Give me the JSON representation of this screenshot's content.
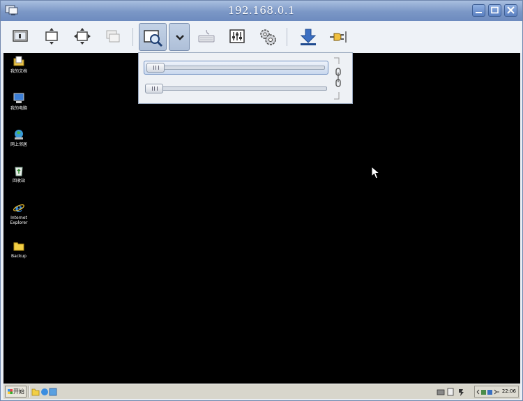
{
  "window": {
    "title": "192.168.0.1"
  },
  "toolbar": {
    "buttons": [
      {
        "name": "fullscreen",
        "icon": "fullscreen-icon"
      },
      {
        "name": "fit-width",
        "icon": "fit-width-icon"
      },
      {
        "name": "fit-window",
        "icon": "fit-window-icon"
      },
      {
        "name": "windowed",
        "icon": "windowed-icon"
      },
      {
        "name": "zoom",
        "icon": "zoom-icon",
        "active": true
      },
      {
        "name": "zoom-dropdown",
        "icon": "chevron-down-icon"
      },
      {
        "name": "keyboard",
        "icon": "keyboard-icon"
      },
      {
        "name": "adjustments",
        "icon": "equalizer-icon"
      },
      {
        "name": "settings",
        "icon": "gears-icon"
      },
      {
        "name": "download",
        "icon": "download-arrow-icon"
      },
      {
        "name": "disconnect",
        "icon": "plug-icon"
      }
    ]
  },
  "zoom_popup": {
    "slider_1_level": 0.0,
    "slider_2_level": 0.0,
    "link_icon": "chain-link-icon"
  },
  "desktop": {
    "icons": [
      {
        "label": "我的文档",
        "icon": "my-documents-icon"
      },
      {
        "label": "我的电脑",
        "icon": "my-computer-icon"
      },
      {
        "label": "网上邻居",
        "icon": "network-places-icon"
      },
      {
        "label": "回收站",
        "icon": "recycle-bin-icon"
      },
      {
        "label_line1": "Internet",
        "label_line2": "Explorer",
        "icon": "internet-explorer-icon"
      },
      {
        "label": "Backup",
        "icon": "folder-icon"
      }
    ]
  },
  "taskbar": {
    "start_label": "开始",
    "clock": "22:06"
  },
  "colors": {
    "remote_background": "#000000",
    "titlebar": "#7b97c6",
    "accent": "#3b6fc2"
  }
}
